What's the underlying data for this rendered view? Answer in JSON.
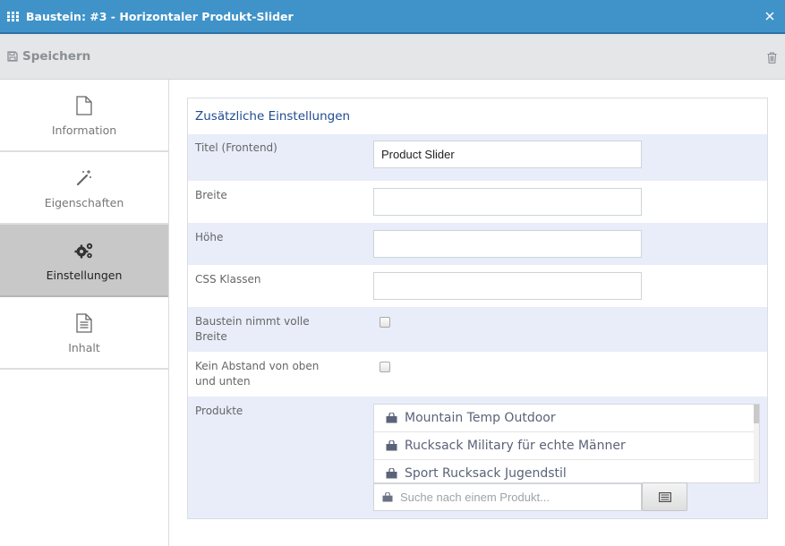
{
  "window": {
    "title": "Baustein: #3 - Horizontaler Produkt-Slider"
  },
  "toolbar": {
    "save_label": "Speichern"
  },
  "sidebar": {
    "items": [
      {
        "label": "Information",
        "icon": "file-icon"
      },
      {
        "label": "Eigenschaften",
        "icon": "magic-wand-icon"
      },
      {
        "label": "Einstellungen",
        "icon": "gears-icon",
        "active": true
      },
      {
        "label": "Inhalt",
        "icon": "document-text-icon"
      }
    ]
  },
  "panel": {
    "heading": "Zusätzliche Einstellungen",
    "fields": {
      "title": {
        "label": "Titel (Frontend)",
        "value": "Product Slider"
      },
      "width": {
        "label": "Breite",
        "value": ""
      },
      "height": {
        "label": "Höhe",
        "value": ""
      },
      "css": {
        "label": "CSS Klassen",
        "value": ""
      },
      "fullwidth": {
        "label": "Baustein nimmt volle Breite",
        "checked": false
      },
      "nospacing": {
        "label": "Kein Abstand von oben und unten",
        "checked": false
      },
      "products": {
        "label": "Produkte",
        "items": [
          "Mountain Temp Outdoor",
          "Rucksack Military für echte Männer",
          "Sport Rucksack Jugendstil"
        ],
        "search_placeholder": "Suche nach einem Produkt..."
      }
    }
  },
  "colors": {
    "titlebar": "#3f93c9",
    "accent_text": "#1f4b8f",
    "row_highlight": "#e8edf9"
  }
}
